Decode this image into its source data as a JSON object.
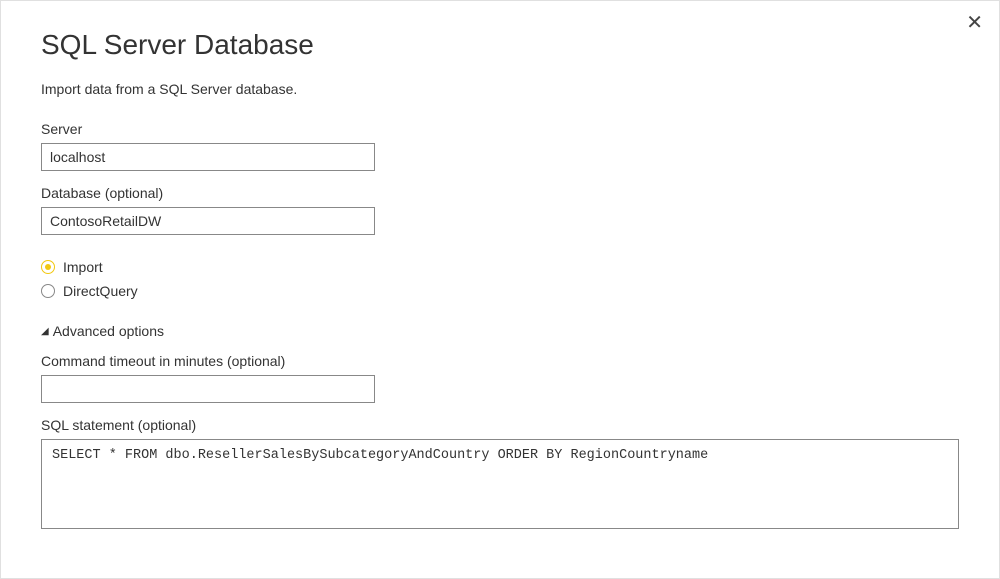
{
  "dialog": {
    "title": "SQL Server Database",
    "subtitle": "Import data from a SQL Server database."
  },
  "fields": {
    "server": {
      "label": "Server",
      "value": "localhost"
    },
    "database": {
      "label": "Database (optional)",
      "value": "ContosoRetailDW"
    },
    "timeout": {
      "label": "Command timeout in minutes (optional)",
      "value": ""
    },
    "sql": {
      "label": "SQL statement (optional)",
      "value": "SELECT * FROM dbo.ResellerSalesBySubcategoryAndCountry ORDER BY RegionCountryname"
    }
  },
  "mode": {
    "import": "Import",
    "directquery": "DirectQuery"
  },
  "advanced": {
    "label": "Advanced options"
  }
}
